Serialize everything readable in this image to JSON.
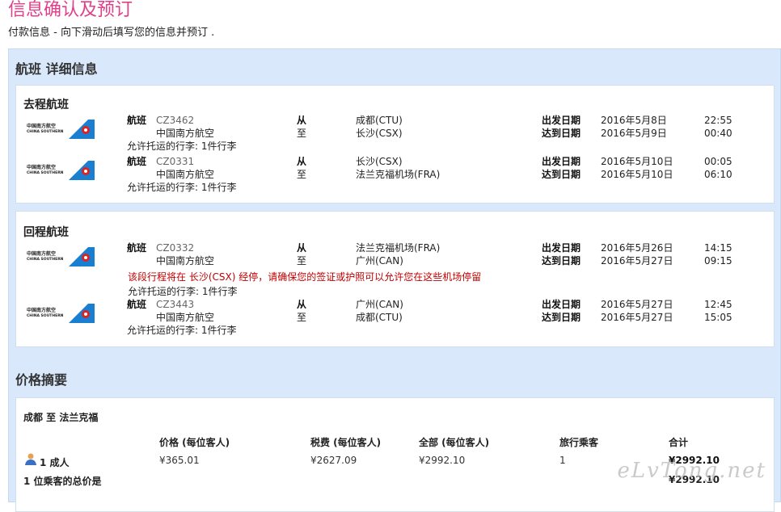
{
  "header": {
    "title": "信息确认及预订",
    "subtitle": "付款信息 - 向下滑动后填写您的信息并预订 ."
  },
  "flight_details": {
    "title": "航班 详细信息",
    "labels": {
      "flight": "航班",
      "from": "从",
      "to": "至",
      "depart_date": "出发日期",
      "arrive_date": "达到日期"
    },
    "airline_logo": {
      "cn": "中国南方航空",
      "en": "CHINA SOUTHERN"
    },
    "outbound": {
      "title": "去程航班",
      "segments": [
        {
          "flight_no": "CZ3462",
          "airline": "中国南方航空",
          "from": "成都(CTU)",
          "to": "长沙(CSX)",
          "dep_date": "2016年5月8日",
          "dep_time": "22:55",
          "arr_date": "2016年5月9日",
          "arr_time": "00:40",
          "baggage": "允许托运的行李: 1件行李"
        },
        {
          "flight_no": "CZ0331",
          "airline": "中国南方航空",
          "from": "长沙(CSX)",
          "to": "法兰克福机场(FRA)",
          "dep_date": "2016年5月10日",
          "dep_time": "00:05",
          "arr_date": "2016年5月10日",
          "arr_time": "06:10",
          "baggage": "允许托运的行李: 1件行李"
        }
      ]
    },
    "return": {
      "title": "回程航班",
      "segments": [
        {
          "flight_no": "CZ0332",
          "airline": "中国南方航空",
          "from": "法兰克福机场(FRA)",
          "to": "广州(CAN)",
          "dep_date": "2016年5月26日",
          "dep_time": "14:15",
          "arr_date": "2016年5月27日",
          "arr_time": "09:15",
          "baggage": "允许托运的行李: 1件行李"
        },
        {
          "flight_no": "CZ3443",
          "airline": "中国南方航空",
          "from": "广州(CAN)",
          "to": "成都(CTU)",
          "dep_date": "2016年5月27日",
          "dep_time": "12:45",
          "arr_date": "2016年5月27日",
          "arr_time": "15:05",
          "baggage": "允许托运的行李: 1件行李"
        }
      ],
      "warning": "该段行程将在 长沙(CSX) 经停，请确保您的签证或护照可以允许您在这些机场停留"
    }
  },
  "price_summary": {
    "title": "价格摘要",
    "route": "成都 至 法兰克福",
    "headers": [
      "价格 (每位客人)",
      "税费 (每位客人)",
      "全部 (每位客人)",
      "旅行乘客",
      "合计"
    ],
    "row": {
      "passenger_type": "1 成人",
      "price": "¥365.01",
      "tax": "¥2627.09",
      "total_per": "¥2992.10",
      "count": "1",
      "sum": "¥2992.10"
    },
    "total_label": "1 位乘客的总价是",
    "total_value": "¥2992.10"
  },
  "watermark": "eLvTong.net",
  "colors": {
    "title": "#e0408a",
    "panel_bg": "#d9e9fb",
    "warning": "#c00000",
    "logo_blue": "#1a7fd1"
  }
}
